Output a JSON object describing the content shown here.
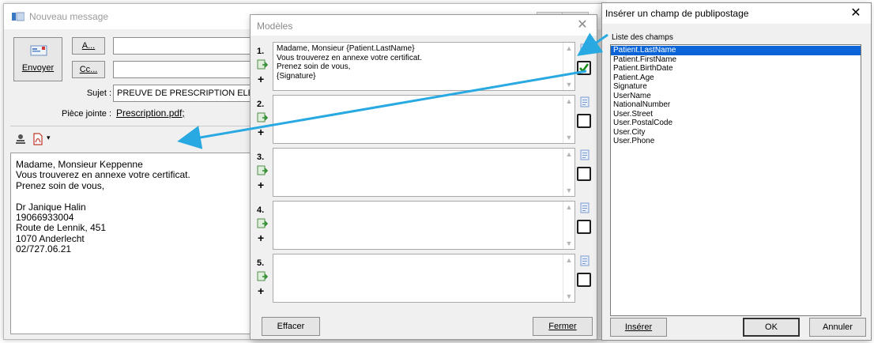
{
  "message": {
    "title": "Nouveau message",
    "send_label": "Envoyer",
    "to_label": "A...",
    "cc_label": "Cc...",
    "to_value": "",
    "cc_value": "",
    "subject_label": "Sujet :",
    "subject_value": "PREUVE DE PRESCRIPTION ELE",
    "attachment_label": "Pièce jointe :",
    "attachment_value": "Prescription.pdf;",
    "body_lines": [
      "Madame, Monsieur Keppenne",
      "Vous trouverez en annexe votre certificat.",
      "Prenez soin de vous,",
      "",
      "Dr Janique Halin",
      "19066933004",
      "Route de Lennik, 451",
      "1070 Anderlecht",
      "02/727.06.21"
    ]
  },
  "models": {
    "title": "Modèles",
    "templates": [
      {
        "number": "1.",
        "checked": true,
        "lines": [
          "Madame, Monsieur {Patient.LastName}",
          "Vous trouverez en annexe votre certificat.",
          "Prenez soin de vous,",
          "{Signature}"
        ]
      },
      {
        "number": "2.",
        "checked": false,
        "lines": []
      },
      {
        "number": "3.",
        "checked": false,
        "lines": []
      },
      {
        "number": "4.",
        "checked": false,
        "lines": []
      },
      {
        "number": "5.",
        "checked": false,
        "lines": []
      }
    ],
    "clear_label": "Effacer",
    "close_label": "Fermer"
  },
  "merge": {
    "title": "Insérer un champ de publipostage",
    "list_caption": "Liste des champs",
    "fields": [
      "Patient.LastName",
      "Patient.FirstName",
      "Patient.BirthDate",
      "Patient.Age",
      "Signature",
      "UserName",
      "NationalNumber",
      "User.Street",
      "User.PostalCode",
      "User.City",
      "User.Phone"
    ],
    "selected_index": 0,
    "insert_label": "Insérer",
    "ok_label": "OK",
    "cancel_label": "Annuler"
  },
  "colors": {
    "arrow": "#29a9e1",
    "selection": "#0a64d7",
    "check": "#1c8c1c"
  }
}
